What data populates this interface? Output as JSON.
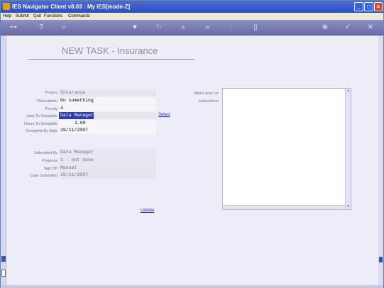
{
  "window": {
    "title": "IES Navigator Client v8.03 : My IES :",
    "mode": "[mode-Z]"
  },
  "menu": {
    "items": [
      "Help",
      "Submit",
      "Quit",
      "Functions",
      "Commands"
    ]
  },
  "toolbar": {
    "icons": [
      "key-icon",
      "help-icon",
      "search-icon",
      "heart-icon",
      "refresh-icon",
      "rewind-icon",
      "fast-forward-icon",
      "tree-icon",
      "document-icon",
      "globe-icon",
      "check-icon",
      "close-icon"
    ]
  },
  "form": {
    "title": "NEW TASK - Insurance",
    "project_label": "Project",
    "project_value": "Insurance",
    "description_label": "*Description",
    "description_value": "Do something",
    "priority_label": "Priority",
    "priority_value": "4",
    "user_label": "User To Complete",
    "user_value": "Data Manager",
    "select_link": "Select",
    "hours_label": "Hours To Complete",
    "hours_value": "1.00",
    "date_label": "Complete By Date",
    "date_value": "19/11/2007",
    "submitted_by_label": "Submitted By",
    "submitted_by_value": "Data Manager",
    "progress_label": "Progress",
    "progress_value": "1 - not done",
    "signoff_label": "Sign Off",
    "signoff_value": "Manual",
    "date_submitted_label": "Date Submitted",
    "date_submitted_value": "19/11/2007",
    "notes_label_1": "Notes and / or",
    "notes_label_2": "Instructions",
    "update_link": "Update"
  }
}
